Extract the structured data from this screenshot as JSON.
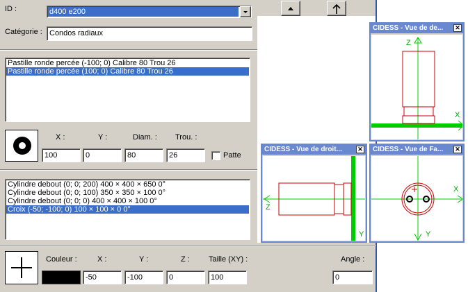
{
  "form": {
    "id_label": "ID :",
    "id_value": "d400 e200",
    "category_label": "Catégorie :",
    "category_value": "Condos radiaux"
  },
  "pads": {
    "rows": [
      "Pastille ronde percée   (-100; 0)   Calibre 80   Trou 26",
      "Pastille ronde percée   (100; 0)   Calibre 80   Trou 26"
    ],
    "selected_index": 1,
    "x_label": "X :",
    "y_label": "Y :",
    "diam_label": "Diam. :",
    "hole_label": "Trou. :",
    "x_value": "100",
    "y_value": "0",
    "diam_value": "80",
    "hole_value": "26",
    "patte_label": "Patte",
    "patte_checked": false
  },
  "shapes": {
    "rows": [
      "Cylindre debout   (0; 0; 200)   400 × 400 × 650   0°",
      "Cylindre debout   (0; 0; 100)   350 × 350 × 100   0°",
      "Cylindre debout   (0; 0; 0)   400 × 400 × 100   0°",
      "Croix   (-50; -100; 0)   100 × 100 × 0   0°"
    ],
    "selected_index": 3,
    "color_label": "Couleur :",
    "x_label": "X :",
    "y_label": "Y :",
    "z_label": "Z :",
    "size_label": "Taille (XY) :",
    "angle_label": "Angle :",
    "color_value": "#000000",
    "x_value": "-50",
    "y_value": "-100",
    "z_value": "0",
    "size_value": "100",
    "angle_value": "0"
  },
  "windows": {
    "top": {
      "title": "CIDESS - Vue de de...",
      "axis_v": "Z",
      "axis_h": "X"
    },
    "right": {
      "title": "CIDESS - Vue de droit...",
      "axis_h": "Z",
      "axis_v": "Y"
    },
    "front": {
      "title": "CIDESS - Vue de Fa...",
      "axis_h": "X",
      "axis_v": "Y"
    }
  },
  "icons": {
    "up": "up-triangle-icon",
    "arrow_up": "arrow-up-icon",
    "dropdown": "chevron-down-icon",
    "close": "close-icon",
    "pad": "round-pad-icon",
    "cross": "cross-icon"
  },
  "colors": {
    "panel": "#d4d0c8",
    "selection": "#3a6ec8",
    "window_title": "#6a88d0",
    "guide": "#00cc00",
    "shape": "#cc0000"
  }
}
